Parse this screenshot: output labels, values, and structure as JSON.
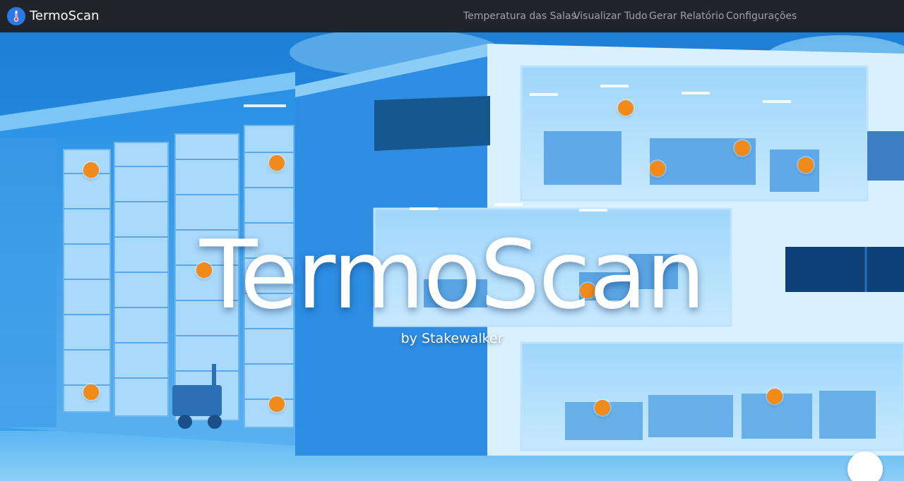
{
  "navbar": {
    "brand": "TermoScan",
    "brand_icon": "thermometer-icon",
    "links": [
      "Temperatura das Salas",
      "Visualizar Tudo",
      "Gerar Relatório",
      "Configurações"
    ]
  },
  "hero": {
    "title": "TermoScan",
    "subtitle": "by Stakewalker"
  },
  "sensors": {
    "count": 11,
    "color": "#f08a1a"
  },
  "colors": {
    "navbar": "#212529",
    "nav_link": "#9ea2a7",
    "brand_icon_bg": "#2979e8",
    "scene_tint": "#1e8ee6"
  }
}
